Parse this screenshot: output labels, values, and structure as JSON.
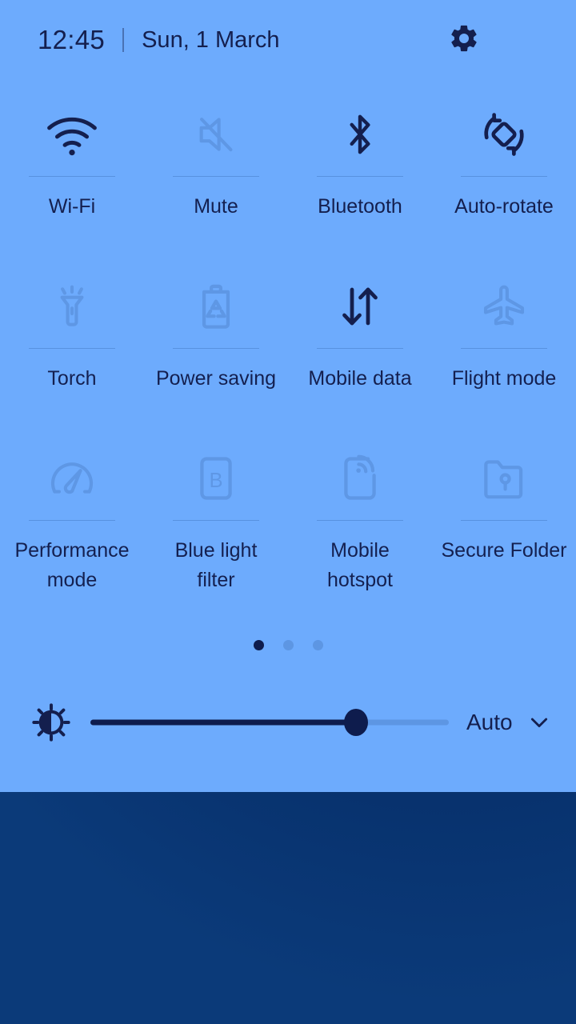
{
  "theme": {
    "panel_bg": "#6dabfd",
    "ink": "#141f4e",
    "ink_faded": "#5d96e3",
    "wallpaper_dark": "#021c4e"
  },
  "header": {
    "clock": "12:45",
    "separator": "|",
    "date": "Sun, 1 March",
    "settings_icon": "gear-icon",
    "menu_icon": "three-dot-menu-icon"
  },
  "quick_settings": {
    "tiles": [
      {
        "label": "Wi-Fi",
        "icon": "wifi-icon",
        "state": "on"
      },
      {
        "label": "Mute",
        "icon": "mute-icon",
        "state": "off"
      },
      {
        "label": "Bluetooth",
        "icon": "bluetooth-icon",
        "state": "on"
      },
      {
        "label": "Auto-rotate",
        "icon": "auto-rotate-icon",
        "state": "on"
      },
      {
        "label": "Torch",
        "icon": "torch-icon",
        "state": "off"
      },
      {
        "label": "Power saving",
        "icon": "power-saving-icon",
        "state": "off"
      },
      {
        "label": "Mobile data",
        "icon": "mobile-data-icon",
        "state": "on"
      },
      {
        "label": "Flight mode",
        "icon": "flight-mode-icon",
        "state": "off"
      },
      {
        "label": "Performance\nmode",
        "icon": "performance-mode-icon",
        "state": "off"
      },
      {
        "label": "Blue light\nfilter",
        "icon": "blue-light-filter-icon",
        "state": "off"
      },
      {
        "label": "Mobile\nhotspot",
        "icon": "mobile-hotspot-icon",
        "state": "off"
      },
      {
        "label": "Secure Folder",
        "icon": "secure-folder-icon",
        "state": "off"
      }
    ]
  },
  "pagination": {
    "total_pages": 3,
    "current_page": 1
  },
  "brightness": {
    "icon": "brightness-icon",
    "value_percent": 74,
    "auto_label": "Auto",
    "chevron_icon": "chevron-down-icon"
  },
  "panel_handle": {
    "icon": "drag-handle-icon"
  }
}
